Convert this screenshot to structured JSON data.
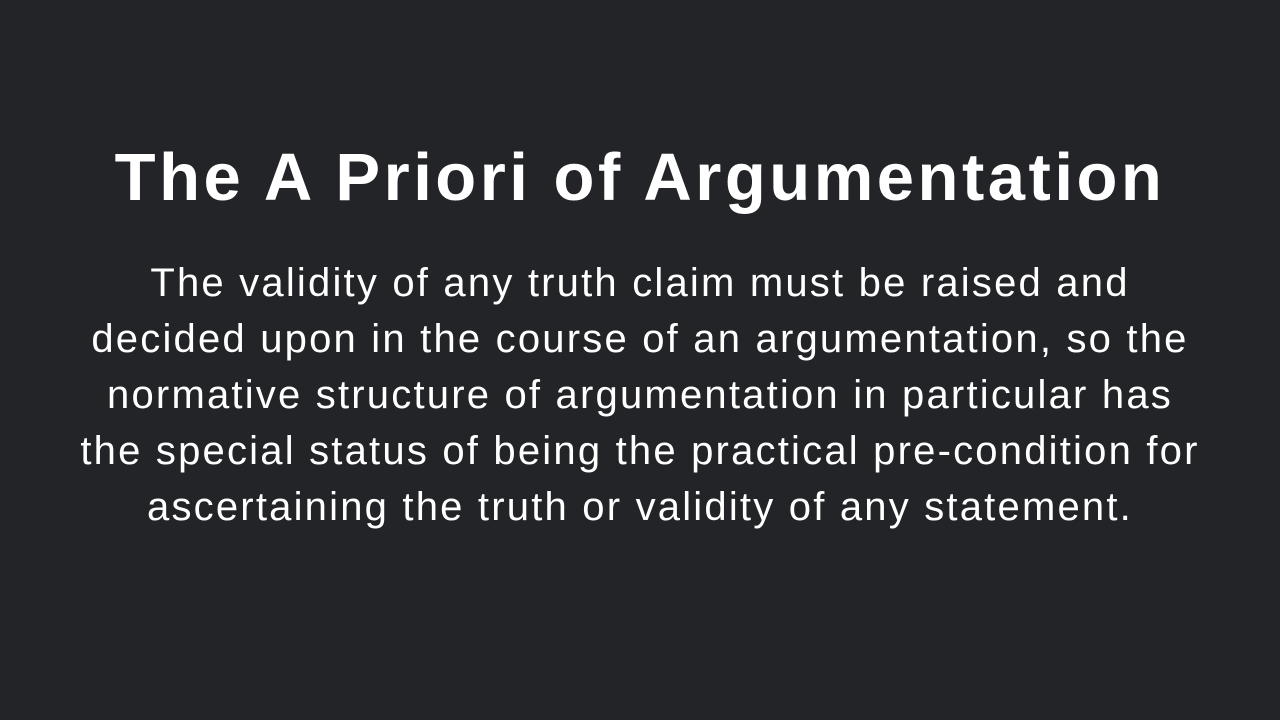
{
  "slide": {
    "title": "The A Priori of Argumentation",
    "body": "The validity of any truth claim must be raised and decided upon in the course of an argumentation, so the normative structure of argumentation in particular has the special status of being the practical pre-condition for ascertaining the truth or validity of any statement."
  },
  "colors": {
    "background": "#232428",
    "text": "#ffffff"
  }
}
